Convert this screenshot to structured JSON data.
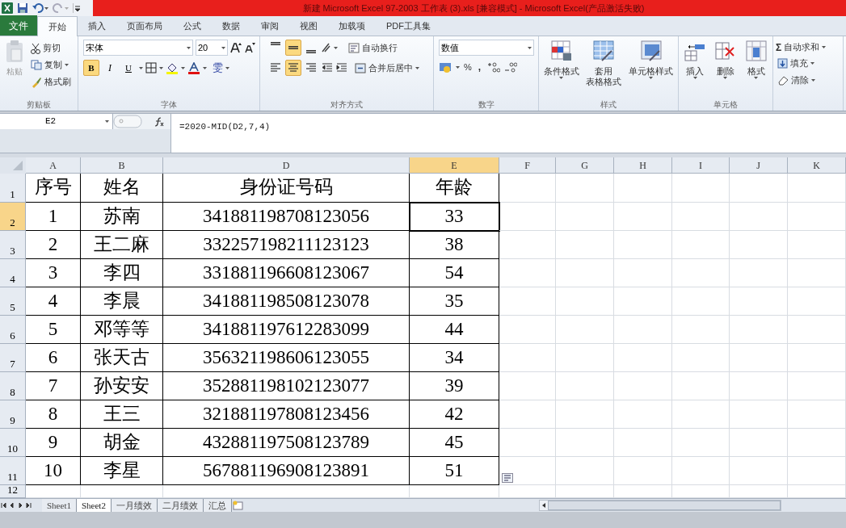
{
  "title_bar": {
    "title": "新建 Microsoft Excel 97-2003 工作表 (3).xls  [兼容模式]  -  Microsoft Excel(产品激活失败)"
  },
  "menu_tabs": [
    {
      "label": "文件",
      "kind": "file",
      "selected": false
    },
    {
      "label": "开始",
      "kind": "tab",
      "selected": true
    },
    {
      "label": "插入",
      "kind": "tab",
      "selected": false
    },
    {
      "label": "页面布局",
      "kind": "tab",
      "selected": false
    },
    {
      "label": "公式",
      "kind": "tab",
      "selected": false
    },
    {
      "label": "数据",
      "kind": "tab",
      "selected": false
    },
    {
      "label": "审阅",
      "kind": "tab",
      "selected": false
    },
    {
      "label": "视图",
      "kind": "tab",
      "selected": false
    },
    {
      "label": "加载项",
      "kind": "tab",
      "selected": false
    },
    {
      "label": "PDF工具集",
      "kind": "tab",
      "selected": false
    }
  ],
  "ribbon": {
    "clipboard": {
      "paste": "粘贴",
      "cut": "剪切",
      "copy": "复制",
      "format_painter": "格式刷",
      "label": "剪贴板"
    },
    "font": {
      "font_name": "宋体",
      "font_size": "20",
      "bold": {
        "text": "B",
        "active": true
      },
      "italic": {
        "text": "I",
        "active": false
      },
      "underline": {
        "text": "U",
        "active": false
      },
      "phonetic": "雯",
      "label": "字体"
    },
    "alignment": {
      "vertical": [
        {
          "selected": false
        },
        {
          "selected": true
        },
        {
          "selected": false
        }
      ],
      "horizontal": [
        {
          "selected": false
        },
        {
          "selected": true
        },
        {
          "selected": false
        }
      ],
      "wrap_text": "自动换行",
      "merge_center": "合并后居中",
      "label": "对齐方式"
    },
    "number": {
      "format": "数值",
      "percent": "%",
      "comma": ",",
      "label": "数字"
    },
    "styles": {
      "conditional_format": "条件格式",
      "table_format": [
        "套用",
        "表格格式"
      ],
      "cell_styles": "单元格样式",
      "label": "样式"
    },
    "cells": {
      "insert": "插入",
      "delete": "删除",
      "format": "格式",
      "label": "单元格"
    },
    "editing": {
      "autosum_symbol": "Σ",
      "autosum": "自动求和",
      "fill": "填充",
      "clear": "清除"
    }
  },
  "formula_bar": {
    "name_box": "E2",
    "formula": "=2020-MID(D2,7,4)"
  },
  "sheet": {
    "columns": [
      {
        "label": "A",
        "selected": false
      },
      {
        "label": "B",
        "selected": false
      },
      {
        "label": "D",
        "selected": false
      },
      {
        "label": "E",
        "selected": true
      },
      {
        "label": "F",
        "selected": false
      },
      {
        "label": "G",
        "selected": false
      },
      {
        "label": "H",
        "selected": false
      },
      {
        "label": "I",
        "selected": false
      },
      {
        "label": "J",
        "selected": false
      },
      {
        "label": "K",
        "selected": false
      }
    ],
    "rows": [
      {
        "header": "1",
        "selected": false,
        "cells": [
          "序号",
          "姓名",
          "身份证号码",
          "年龄"
        ]
      },
      {
        "header": "2",
        "selected": true,
        "cells": [
          "1",
          "苏南",
          "341881198708123056",
          "33"
        ]
      },
      {
        "header": "3",
        "selected": false,
        "cells": [
          "2",
          "王二麻",
          "332257198211123123",
          "38"
        ]
      },
      {
        "header": "4",
        "selected": false,
        "cells": [
          "3",
          "李四",
          "331881196608123067",
          "54"
        ]
      },
      {
        "header": "5",
        "selected": false,
        "cells": [
          "4",
          "李晨",
          "341881198508123078",
          "35"
        ]
      },
      {
        "header": "6",
        "selected": false,
        "cells": [
          "5",
          "邓等等",
          "341881197612283099",
          "44"
        ]
      },
      {
        "header": "7",
        "selected": false,
        "cells": [
          "6",
          "张天古",
          "356321198606123055",
          "34"
        ]
      },
      {
        "header": "8",
        "selected": false,
        "cells": [
          "7",
          "孙安安",
          "352881198102123077",
          "39"
        ]
      },
      {
        "header": "9",
        "selected": false,
        "cells": [
          "8",
          "王三",
          "321881197808123456",
          "42"
        ]
      },
      {
        "header": "10",
        "selected": false,
        "cells": [
          "9",
          "胡金",
          "432881197508123789",
          "45"
        ]
      },
      {
        "header": "11",
        "selected": false,
        "cells": [
          "10",
          "李星",
          "567881196908123891",
          "51"
        ]
      },
      {
        "header": "12",
        "selected": false,
        "cells": []
      }
    ]
  },
  "sheet_tabs": [
    {
      "label": "Sheet1",
      "selected": false
    },
    {
      "label": "Sheet2",
      "selected": true
    },
    {
      "label": "一月绩效",
      "selected": false
    },
    {
      "label": "二月绩效",
      "selected": false
    },
    {
      "label": "汇总",
      "selected": false
    }
  ]
}
